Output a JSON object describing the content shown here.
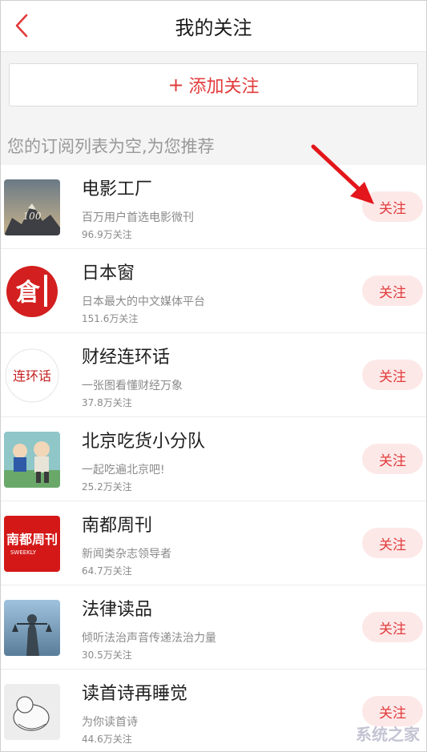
{
  "header": {
    "title": "我的关注",
    "back_icon": "chevron-left-icon"
  },
  "add": {
    "plus": "+",
    "label": "添加关注"
  },
  "hint": "您的订阅列表为空,为您推荐",
  "follow_label": "关注",
  "items": [
    {
      "name": "电影工厂",
      "desc": "百万用户首选电影微刊",
      "count": "96.9万关注"
    },
    {
      "name": "日本窗",
      "desc": "日本最大的中文媒体平台",
      "count": "151.6万关注"
    },
    {
      "name": "财经连环话",
      "desc": "一张图看懂财经万象",
      "count": "37.8万关注"
    },
    {
      "name": "北京吃货小分队",
      "desc": "一起吃遍北京吧!",
      "count": "25.2万关注"
    },
    {
      "name": "南都周刊",
      "desc": "新闻类杂志领导者",
      "count": "64.7万关注"
    },
    {
      "name": "法律读品",
      "desc": "倾听法治声音传递法治力量",
      "count": "30.5万关注"
    },
    {
      "name": "读首诗再睡觉",
      "desc": "为你读首诗",
      "count": "44.6万关注"
    }
  ],
  "logos": {
    "nandu_main": "南都周刊",
    "nandu_sub": "SWEEKLY",
    "caijing": "连环话",
    "ribenchuang": "倉",
    "dianying": "100"
  },
  "watermark": "系统之家",
  "colors": {
    "accent": "#e23b3b",
    "follow_bg": "#fde8e8"
  }
}
